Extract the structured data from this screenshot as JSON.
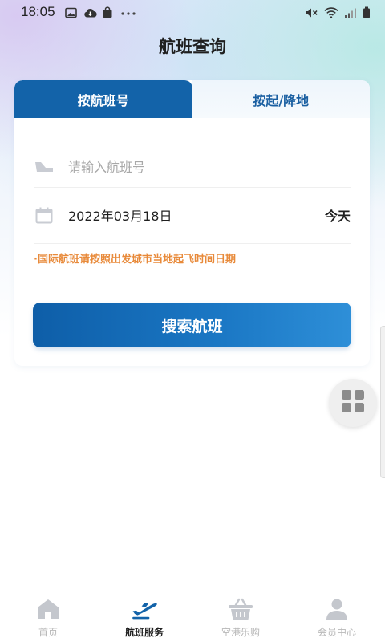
{
  "status_bar": {
    "time": "18:05"
  },
  "page": {
    "title": "航班查询"
  },
  "tabs": [
    {
      "label": "按航班号",
      "active": true
    },
    {
      "label": "按起/降地",
      "active": false
    }
  ],
  "form": {
    "flight_input_placeholder": "请输入航班号",
    "flight_input_value": "",
    "date": "2022年03月18日",
    "date_hint": "今天",
    "notice": "·国际航班请按照出发城市当地起飞时间日期",
    "search_button": "搜索航班"
  },
  "bottom_nav": [
    {
      "label": "首页",
      "icon": "home-icon",
      "active": false
    },
    {
      "label": "航班服务",
      "icon": "airplane-icon",
      "active": true
    },
    {
      "label": "空港乐购",
      "icon": "basket-icon",
      "active": false
    },
    {
      "label": "会员中心",
      "icon": "user-icon",
      "active": false
    }
  ],
  "colors": {
    "primary": "#1363a9",
    "notice": "#e88a3a",
    "nav_inactive": "#b8b8b8"
  }
}
